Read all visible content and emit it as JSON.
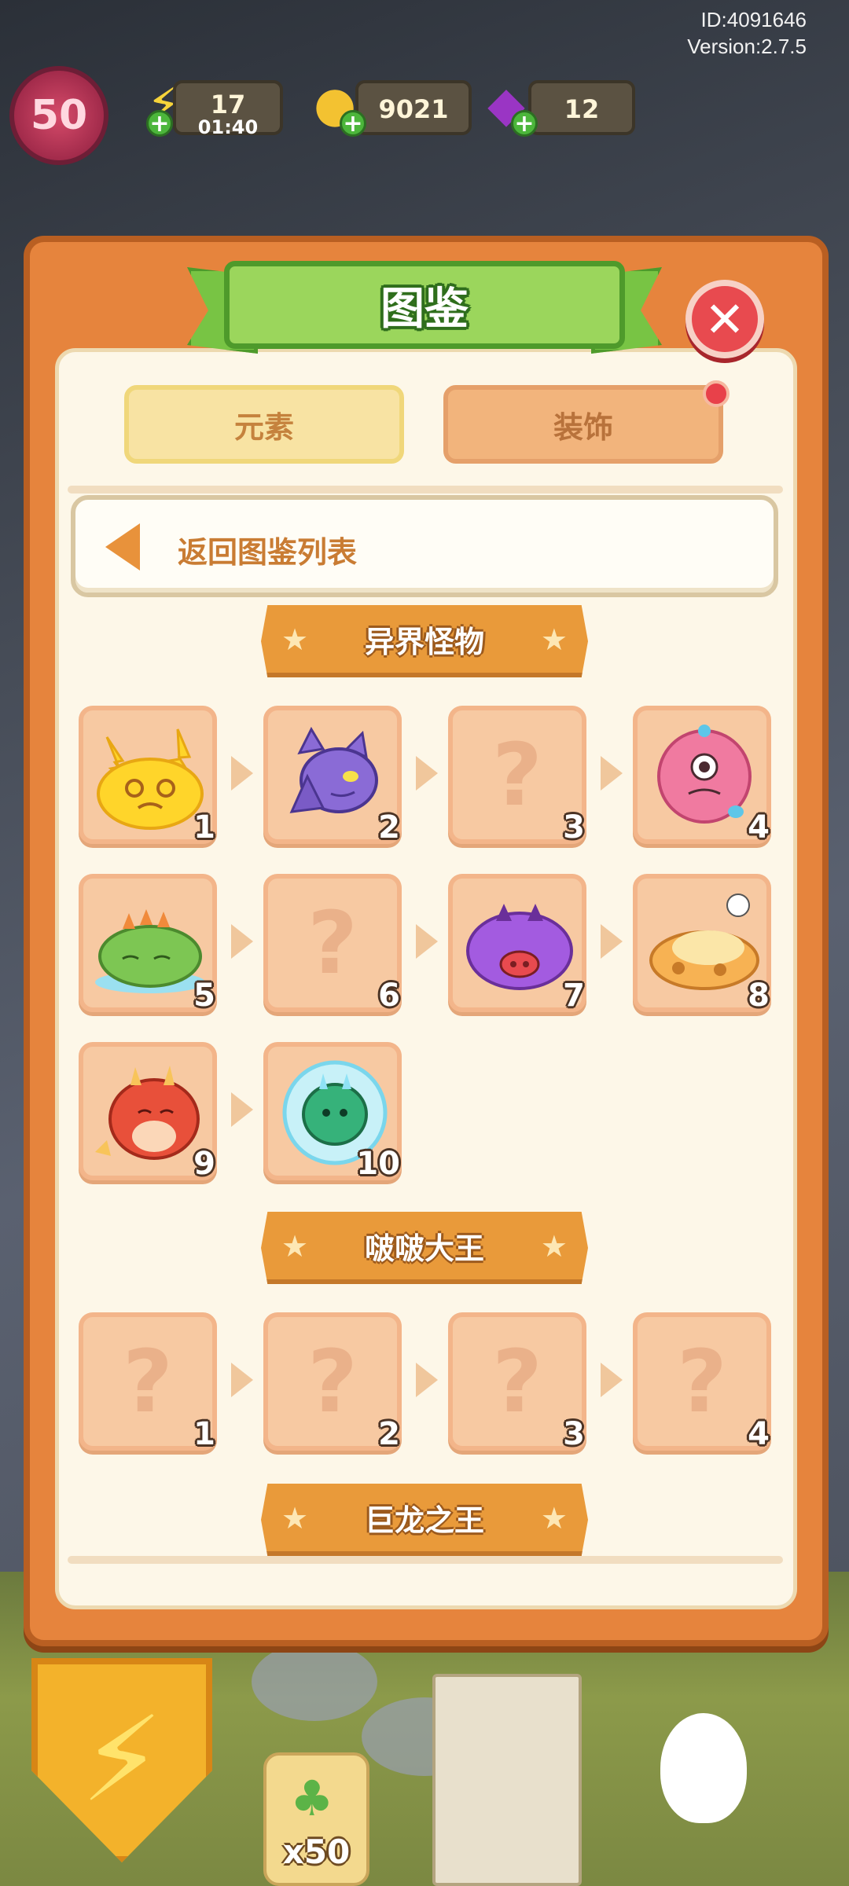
{
  "hud": {
    "id_text": "ID:4091646",
    "version_text": "Version:2.7.5",
    "level": "50",
    "energy": "17",
    "energy_timer": "01:40",
    "coins": "9021",
    "gems": "12",
    "energy_icon": "lightning-icon",
    "coin_icon": "coin-icon",
    "gem_icon": "gem-icon"
  },
  "modal": {
    "title": "图鉴",
    "tabs": [
      {
        "label": "元素",
        "active": true
      },
      {
        "label": "装饰",
        "active": false,
        "has_notification": true
      }
    ],
    "back_label": "返回图鉴列表",
    "sections": [
      {
        "title": "异界怪物",
        "cards": [
          {
            "num": "1",
            "unlocked": true,
            "monster": "yellow-electric-slime"
          },
          {
            "num": "2",
            "unlocked": true,
            "monster": "purple-bat"
          },
          {
            "num": "3",
            "unlocked": false
          },
          {
            "num": "4",
            "unlocked": true,
            "monster": "pink-fluffy-cyclops"
          },
          {
            "num": "5",
            "unlocked": true,
            "monster": "green-dragon-sleeping"
          },
          {
            "num": "6",
            "unlocked": false
          },
          {
            "num": "7",
            "unlocked": true,
            "monster": "purple-fuzzy-boar"
          },
          {
            "num": "8",
            "unlocked": true,
            "monster": "orange-lying-creature"
          },
          {
            "num": "9",
            "unlocked": true,
            "monster": "red-baby-dragon"
          },
          {
            "num": "10",
            "unlocked": true,
            "monster": "green-ice-dragon"
          }
        ]
      },
      {
        "title": "啵啵大王",
        "cards": [
          {
            "num": "1",
            "unlocked": false
          },
          {
            "num": "2",
            "unlocked": false
          },
          {
            "num": "3",
            "unlocked": false
          },
          {
            "num": "4",
            "unlocked": false
          }
        ]
      },
      {
        "title": "巨龙之王",
        "cards": []
      }
    ],
    "locked_glyph": "?"
  },
  "bottom": {
    "clover_count": "x50"
  },
  "colors": {
    "modal_orange": "#e6843d",
    "ribbon_green": "#9bd65c",
    "close_red": "#e84a4f",
    "card_peach": "#f7c9a2"
  }
}
